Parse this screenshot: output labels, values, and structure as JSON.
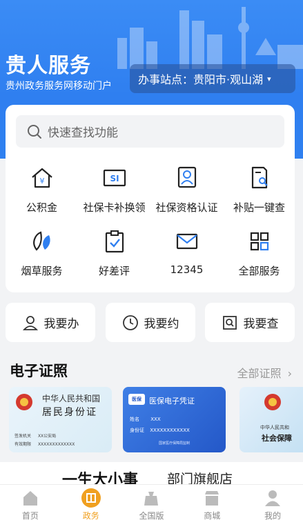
{
  "brand": {
    "title": "贵人服务",
    "subtitle": "贵州政务服务网移动门户"
  },
  "site": {
    "label": "办事站点：贵阳市·观山湖",
    "chevron": "chevron-down-icon"
  },
  "search": {
    "placeholder": "快速查找功能"
  },
  "services": [
    {
      "label": "公积金",
      "icon": "house-yen-icon"
    },
    {
      "label": "社保卡补换领",
      "icon": "social-card-icon"
    },
    {
      "label": "社保资格认证",
      "icon": "user-verify-icon"
    },
    {
      "label": "补贴一键查",
      "icon": "document-search-icon"
    },
    {
      "label": "烟草服务",
      "icon": "leaf-icon"
    },
    {
      "label": "好差评",
      "icon": "clipboard-check-icon"
    },
    {
      "label": "12345",
      "icon": "mail-icon"
    },
    {
      "label": "全部服务",
      "icon": "grid-icon"
    }
  ],
  "quick_actions": [
    {
      "label": "我要办",
      "icon": "person-icon"
    },
    {
      "label": "我要约",
      "icon": "clock-icon"
    },
    {
      "label": "我要查",
      "icon": "search-doc-icon"
    }
  ],
  "certificates": {
    "title": "电子证照",
    "more": "全部证照",
    "id_card": {
      "line1": "中华人民共和国",
      "line2": "居民身份证",
      "f1": "签发机关",
      "v1": "XX公安局",
      "f2": "有效期限",
      "v2": "XXXXXXXXXXXXX"
    },
    "medical": {
      "badge": "医保",
      "title": "医保电子凭证",
      "f1": "姓名",
      "v1": "XXX",
      "f2": "身份证",
      "v2": "XXXXXXXXXXXX",
      "footer": "国家医疗保障局监制"
    },
    "social": {
      "line1": "中华人民共和",
      "line2": "社会保障"
    }
  },
  "promo": {
    "left": "一生大小事",
    "right": "部门旗舰店"
  },
  "tabs": [
    {
      "label": "首页",
      "icon": "home-icon"
    },
    {
      "label": "政务",
      "icon": "gov-icon",
      "active": true
    },
    {
      "label": "全国版",
      "icon": "globe-icon"
    },
    {
      "label": "商城",
      "icon": "shop-icon"
    },
    {
      "label": "我的",
      "icon": "user-icon"
    }
  ],
  "colors": {
    "primary": "#2f80f0",
    "active_tab": "#f0a020",
    "icon_blue": "#2f7ff0"
  }
}
